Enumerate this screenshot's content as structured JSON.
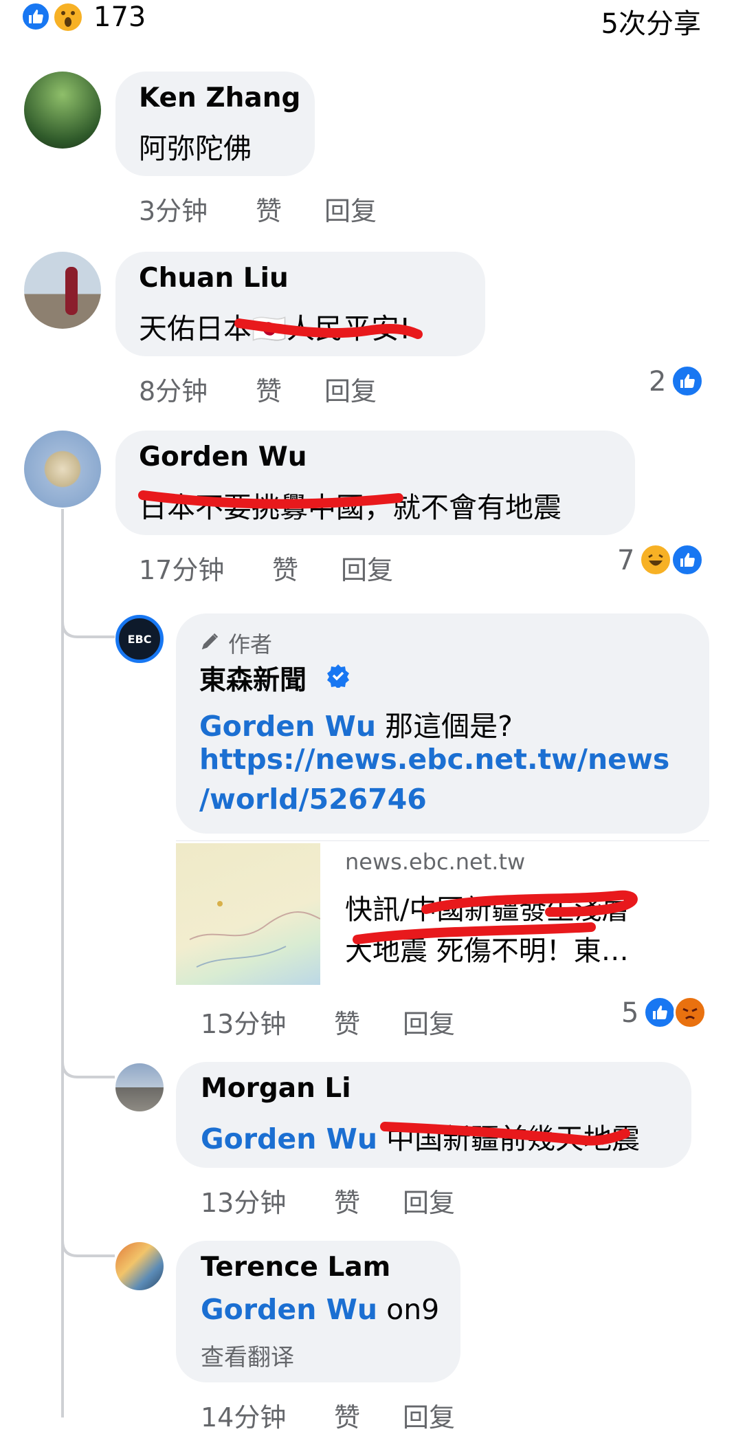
{
  "header": {
    "reaction_count": "173",
    "shares": "5次分享"
  },
  "labels": {
    "like": "赞",
    "reply": "回复"
  },
  "comments": [
    {
      "name": "Ken Zhang",
      "text": "阿弥陀佛",
      "time": "3分钟"
    },
    {
      "name": "Chuan Liu",
      "text": "天佑日本🇯🇵人民平安!",
      "time": "8分钟",
      "reactions": "2"
    },
    {
      "name": "Gorden Wu",
      "text": "日本不要挑釁中國，就不會有地震",
      "time": "17分钟",
      "reactions": "7"
    }
  ],
  "replies": [
    {
      "badge": "作者",
      "name": "東森新聞",
      "mention": "Gorden Wu",
      "text": " 那這個是?",
      "url_line1": "https://news.ebc.net.tw/news",
      "url_line2": "/world/526746",
      "preview_domain": "news.ebc.net.tw",
      "preview_title_1": "快訊/中國新疆發生淺層",
      "preview_title_2": "大地震 死傷不明！東…",
      "time": "13分钟",
      "reactions": "5"
    },
    {
      "name": "Morgan Li",
      "mention": "Gorden Wu",
      "text": " 中国新疆前幾天地震",
      "time": "13分钟"
    },
    {
      "name": "Terence Lam",
      "mention": "Gorden Wu",
      "text": " on9",
      "translate": "查看翻译",
      "time": "14分钟"
    }
  ],
  "colors": {
    "like_blue": "#1877f2",
    "link_blue": "#1b6fd2",
    "meta_gray": "#65676b",
    "bubble_bg": "#f0f2f5",
    "strike_red": "#e8191c"
  }
}
